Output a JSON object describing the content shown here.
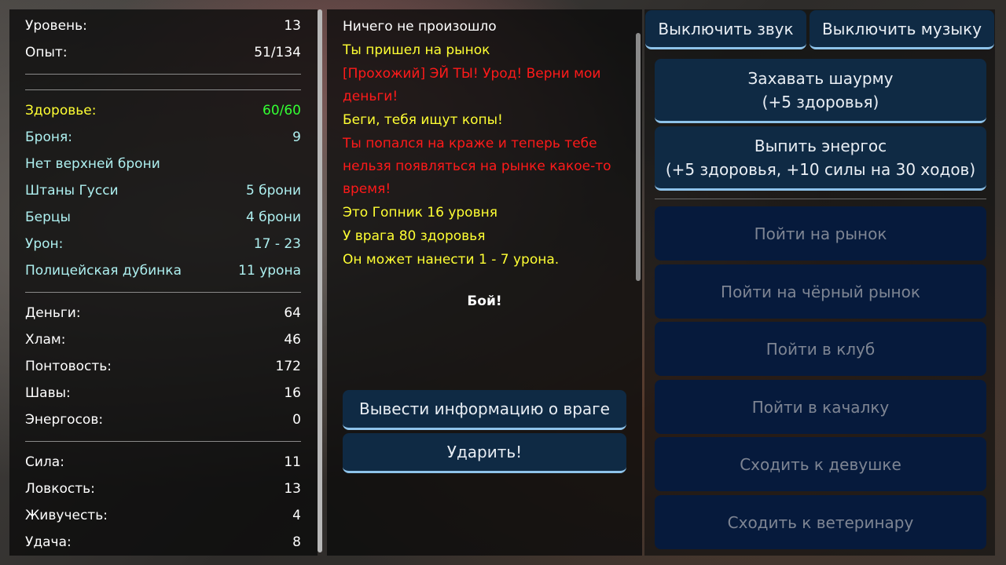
{
  "stats": {
    "level": {
      "label": "Уровень:",
      "value": "13"
    },
    "exp": {
      "label": "Опыт:",
      "value": "51/134"
    },
    "health": {
      "label": "Здоровье:",
      "value": "60/60"
    },
    "armor": {
      "label": "Броня:",
      "value": "9"
    },
    "top_armor": {
      "label": "Нет верхней брони",
      "value": ""
    },
    "pants": {
      "label": "Штаны Гусси",
      "value": "5 брони"
    },
    "boots": {
      "label": "Берцы",
      "value": "4 брони"
    },
    "damage": {
      "label": "Урон:",
      "value": "17 - 23"
    },
    "weapon": {
      "label": "Полицейская дубинка",
      "value": "11 урона"
    },
    "money": {
      "label": "Деньги:",
      "value": "64"
    },
    "junk": {
      "label": "Хлам:",
      "value": "46"
    },
    "swag": {
      "label": "Понтовость:",
      "value": "172"
    },
    "shawarma": {
      "label": "Шавы:",
      "value": "16"
    },
    "energy": {
      "label": "Энергосов:",
      "value": "0"
    },
    "strength": {
      "label": "Сила:",
      "value": "11"
    },
    "agility": {
      "label": "Ловкость:",
      "value": "13"
    },
    "vitality": {
      "label": "Живучесть:",
      "value": "4"
    },
    "luck": {
      "label": "Удача:",
      "value": "8"
    }
  },
  "log": {
    "lines": [
      "Ничего не произошло",
      "Ты пришел на рынок",
      "[Прохожий] ЭЙ ТЫ! Урод! Верни мои",
      "деньги!",
      "Беги, тебя ищут копы!",
      "Ты попался на краже и теперь тебе",
      "нельзя появляться на рынке какое-то",
      "время!",
      "Это Гопник 16 уровня",
      "У врага 80 здоровья",
      "Он может нанести 1 - 7 урона."
    ],
    "fight_label": "Бой!",
    "enemy_info_button": "Вывести информацию о враге",
    "hit_button": "Ударить!"
  },
  "actions": {
    "mute_sound": "Выключить звук",
    "mute_music": "Выключить музыку",
    "eat_shawarma": {
      "line1": "Захавать шаурму",
      "line2": "(+5 здоровья)"
    },
    "drink_energy": {
      "line1": "Выпить энергос",
      "line2": "(+5 здоровья, +10 силы на 30 ходов)"
    },
    "go_market": "Пойти на рынок",
    "go_black_market": "Пойти на чёрный рынок",
    "go_club": "Пойти в клуб",
    "go_gym": "Пойти в качалку",
    "go_girlfriend": "Сходить к девушке",
    "go_vet": "Сходить к ветеринару"
  },
  "colors": {
    "white": "#ffffff",
    "yellow": "#ffff33",
    "red": "#ff1a1a",
    "cyan": "#aef0f0",
    "green": "#33ff33",
    "button": "#0f2a44",
    "button_disabled": "#061a3c"
  }
}
